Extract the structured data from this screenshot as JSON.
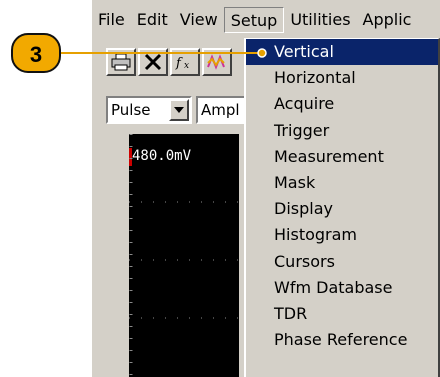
{
  "callout": {
    "step_number": "3"
  },
  "menubar": {
    "items": [
      "File",
      "Edit",
      "View",
      "Setup",
      "Utilities",
      "Applic"
    ],
    "active_index": 3
  },
  "toolbar": {
    "buttons": [
      "printer-icon",
      "tools-icon",
      "fx-icon",
      "waveform-icon"
    ]
  },
  "controls": {
    "waveform_select": "Pulse",
    "second_select": "Ampl"
  },
  "scope": {
    "scale_label": "480.0mV"
  },
  "setup_menu": {
    "items": [
      "Vertical",
      "Horizontal",
      "Acquire",
      "Trigger",
      "Measurement",
      "Mask",
      "Display",
      "Histogram",
      "Cursors",
      "Wfm Database",
      "TDR",
      "Phase Reference"
    ],
    "selected_index": 0
  },
  "colors": {
    "highlight": "#0a246a",
    "callout_fill": "#f2a900",
    "callout_line": "#e6a000",
    "window": "#d4d0c8"
  }
}
